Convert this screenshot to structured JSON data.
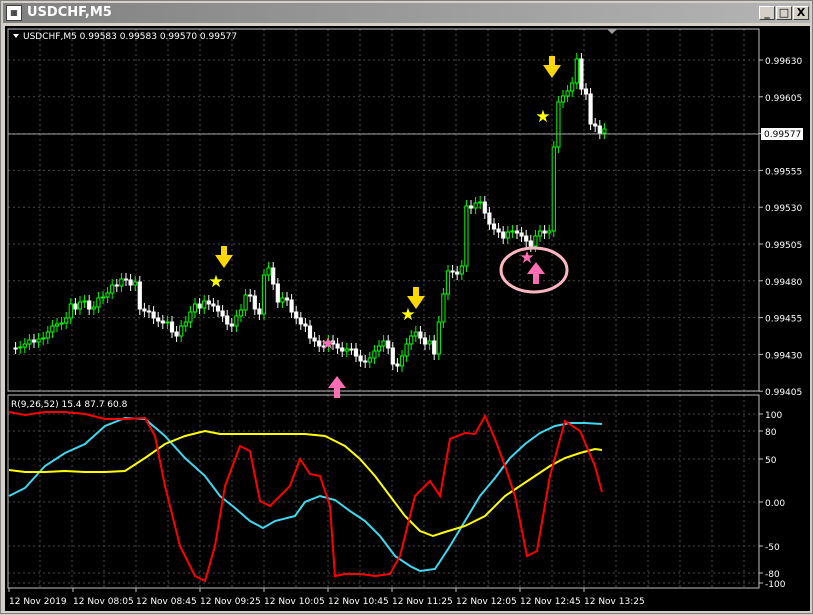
{
  "window": {
    "title": "USDCHF,M5",
    "app_icon": "chart-window-icon",
    "buttons": {
      "minimize": "_",
      "maximize": "□",
      "close": "X"
    }
  },
  "main_pane": {
    "header": "USDCHF,M5  0.99583 0.99583 0.99570 0.99577",
    "price_ticks": [
      "0.99630",
      "0.99605",
      "0.99580",
      "0.99555",
      "0.99530",
      "0.99505",
      "0.99480",
      "0.99455",
      "0.99430",
      "0.99405"
    ],
    "current_price": "0.99577",
    "colors": {
      "bull": "#00ff00",
      "bear": "#ffffff",
      "grid": "#4a4a4a",
      "background": "#000000"
    }
  },
  "indicator_pane": {
    "header": "R(9,26,52) 15.4 87.7 60.8",
    "ticks": [
      "100",
      "80",
      "50",
      "0.00",
      "-50",
      "-80",
      "-100"
    ],
    "colors": {
      "fast": "#ff0000",
      "mid": "#40d8f0",
      "slow": "#ffff00"
    }
  },
  "time_axis": [
    "12 Nov 2019",
    "12 Nov 08:05",
    "12 Nov 08:45",
    "12 Nov 09:25",
    "12 Nov 10:05",
    "12 Nov 10:45",
    "12 Nov 11:25",
    "12 Nov 12:05",
    "12 Nov 12:45",
    "12 Nov 13:25"
  ],
  "markers": {
    "sell_arrow_color": "#ffd700",
    "buy_arrow_color": "#ff6eb4",
    "sell_star_color": "#ffff00",
    "buy_star_color": "#ff6eb4",
    "highlight_ellipse_color": "#ffb6c1"
  }
}
